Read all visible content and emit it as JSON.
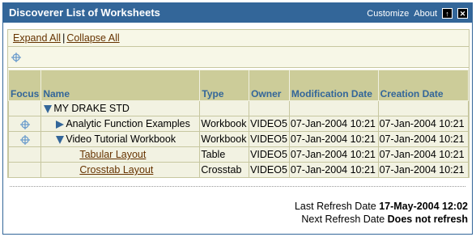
{
  "header": {
    "title": "Discoverer List of Worksheets",
    "customize_label": "Customize",
    "about_label": "About"
  },
  "actions": {
    "expand_all": "Expand All",
    "separator": "|",
    "collapse_all": "Collapse All"
  },
  "table": {
    "columns": {
      "focus": "Focus",
      "name": "Name",
      "type": "Type",
      "owner": "Owner",
      "modification_date": "Modification Date",
      "creation_date": "Creation Date"
    },
    "rows": [
      {
        "name": "MY DRAKE STD",
        "type": "",
        "owner": "",
        "modified": "",
        "created": "",
        "level": 0,
        "expander": "expanded",
        "focus_icon": false,
        "link": false
      },
      {
        "name": "Analytic Function Examples",
        "type": "Workbook",
        "owner": "VIDEO5",
        "modified": "07-Jan-2004 10:21",
        "created": "07-Jan-2004 10:21",
        "level": 1,
        "expander": "collapsed",
        "focus_icon": true,
        "link": false
      },
      {
        "name": "Video Tutorial Workbook",
        "type": "Workbook",
        "owner": "VIDEO5",
        "modified": "07-Jan-2004 10:21",
        "created": "07-Jan-2004 10:21",
        "level": 1,
        "expander": "expanded",
        "focus_icon": true,
        "link": false
      },
      {
        "name": "Tabular Layout",
        "type": "Table",
        "owner": "VIDEO5",
        "modified": "07-Jan-2004 10:21",
        "created": "07-Jan-2004 10:21",
        "level": 2,
        "expander": "none",
        "focus_icon": false,
        "link": true
      },
      {
        "name": "Crosstab Layout",
        "type": "Crosstab",
        "owner": "VIDEO5",
        "modified": "07-Jan-2004 10:21",
        "created": "07-Jan-2004 10:21",
        "level": 2,
        "expander": "none",
        "focus_icon": false,
        "link": true
      }
    ]
  },
  "footer": {
    "last_refresh_label": "Last Refresh Date",
    "last_refresh_value": "17-May-2004 12:02",
    "next_refresh_label": "Next Refresh Date",
    "next_refresh_value": "Does not refresh"
  },
  "colors": {
    "header_bg": "#336699",
    "column_header_bg": "#cccc99",
    "column_header_text": "#336699",
    "row_bg": "#f2f2e2",
    "link": "#663300"
  },
  "icons": {
    "focus": "crosshair-icon",
    "expanded": "triangle-down-icon",
    "collapsed": "triangle-right-icon",
    "title_buttons": [
      "minimize-icon",
      "close-icon"
    ]
  }
}
